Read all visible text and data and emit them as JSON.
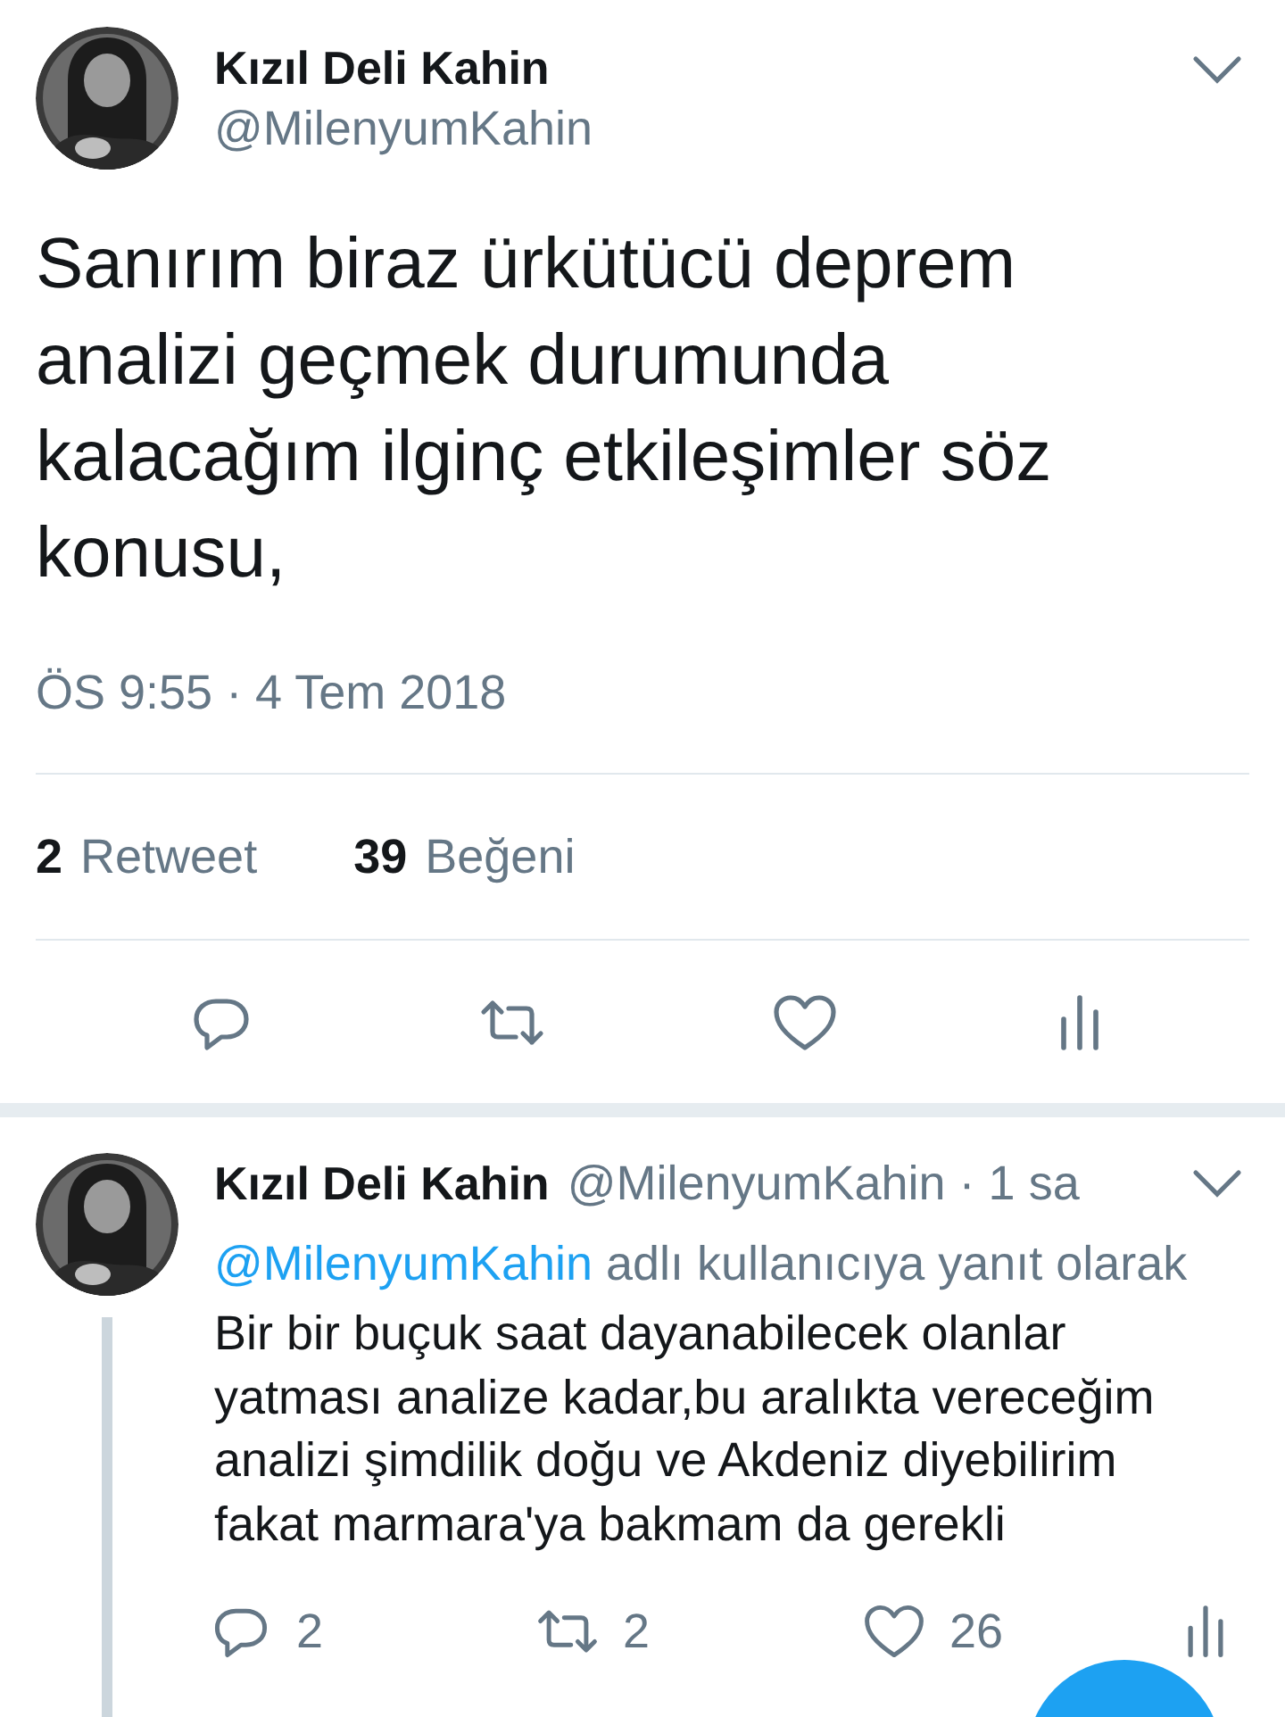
{
  "tweet": {
    "author": "Kızıl Deli Kahin",
    "handle": "@MilenyumKahin",
    "text": "Sanırım biraz ürkütücü deprem analizi geçmek durumunda kalacağım ilginç etkileşimler söz konusu,",
    "timestamp": "ÖS 9:55 · 4 Tem 2018",
    "stats": [
      {
        "count": "2",
        "label": "Retweet"
      },
      {
        "count": "39",
        "label": "Beğeni"
      }
    ],
    "actions": [
      {
        "kind": "reply"
      },
      {
        "kind": "retweet"
      },
      {
        "kind": "like"
      },
      {
        "kind": "analytics"
      }
    ]
  },
  "replies": [
    {
      "author": "Kızıl Deli Kahin",
      "meta": "@MilenyumKahin · 1 sa",
      "reply_to_handle": "@MilenyumKahin",
      "reply_to_text": "adlı kullanıcıya yanıt olarak",
      "text": "Bir bir buçuk saat dayanabilecek olanlar yatması analize kadar,bu aralıkta vereceğim analizi şimdilik doğu ve Akdeniz diyebilirim fakat marmara'ya bakmam da gerekli",
      "thread_continues": true,
      "actions": [
        {
          "kind": "reply",
          "count": "2"
        },
        {
          "kind": "retweet",
          "count": "2"
        },
        {
          "kind": "like",
          "count": "26"
        },
        {
          "kind": "analytics"
        }
      ]
    }
  ]
}
